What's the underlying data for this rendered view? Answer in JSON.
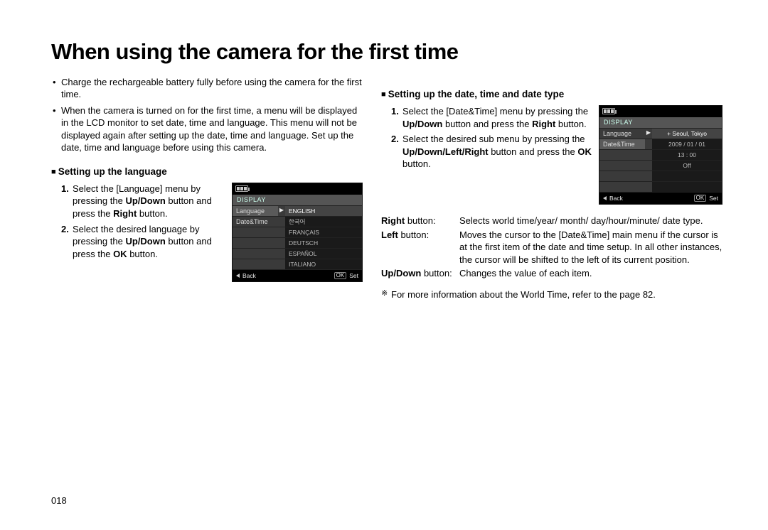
{
  "title": "When using the camera for the first time",
  "page_number": "018",
  "intro_bullets": [
    "Charge the rechargeable battery fully before using the camera for the first time.",
    "When the camera is turned on for the first time, a menu will be displayed in the LCD monitor to set date, time and language. This menu will not be displayed again after setting up the date, time and language. Set up the date, time and language before using this camera."
  ],
  "lang_section": {
    "title": "Setting up the language",
    "steps": {
      "s1_a": "Select the [Language] menu by pressing the ",
      "s1_b": "Up/Down",
      "s1_c": " button and press the ",
      "s1_d": "Right",
      "s1_e": " button.",
      "s2_a": "Select the desired language by pressing the ",
      "s2_b": "Up/Down",
      "s2_c": " button and press the ",
      "s2_d": "OK",
      "s2_e": " button."
    },
    "lcd": {
      "section": "DISPLAY",
      "row1": "Language",
      "row2": "Date&Time",
      "opts": [
        "ENGLISH",
        "한국어",
        "FRANÇAIS",
        "DEUTSCH",
        "ESPAÑOL",
        "ITALIANO"
      ],
      "back": "Back",
      "set": "Set",
      "ok": "OK"
    }
  },
  "date_section": {
    "title": "Setting up the date, time and date type",
    "steps": {
      "s1_a": "Select the [Date&Time] menu by pressing the ",
      "s1_b": "Up/Down",
      "s1_c": " button and press the ",
      "s1_d": "Right",
      "s1_e": " button.",
      "s2_a": "Select the desired sub menu by pressing the ",
      "s2_b": "Up/Down/Left/Right",
      "s2_c": " button and press the ",
      "s2_d": "OK",
      "s2_e": " button."
    },
    "lcd": {
      "section": "DISPLAY",
      "row1": "Language",
      "row2": "Date&Time",
      "opts": [
        "+ Seoul, Tokyo",
        "2009 / 01 / 01",
        "13 : 00",
        "Off"
      ],
      "back": "Back",
      "set": "Set",
      "ok": "OK"
    },
    "defs": {
      "right_label": "Right",
      "right_suffix": " button:",
      "right_def": "Selects world time/year/ month/ day/hour/minute/ date type.",
      "left_label": "Left",
      "left_suffix": " button:",
      "left_def": "Moves the cursor to the [Date&Time] main menu if the cursor is at the first item of the date and time setup. In all other instances, the cursor will be shifted to the left of its current position.",
      "updown_label": "Up/Down",
      "updown_suffix": " button:",
      "updown_def": "Changes the value of each item."
    },
    "note": "For more information about the World Time, refer to the page 82."
  }
}
